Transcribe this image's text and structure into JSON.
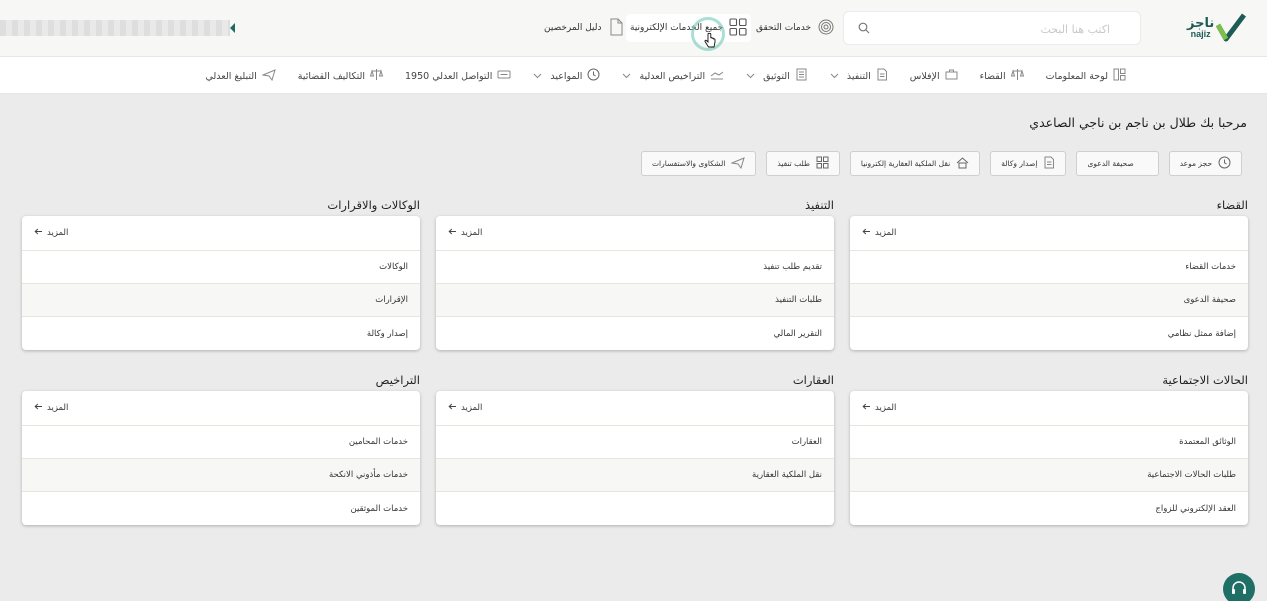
{
  "header": {
    "logo_ar": "ناجز",
    "logo_en": "najiz",
    "search_placeholder": "اكتب هنا البحث",
    "links": {
      "verification": "خدمات التحقق",
      "all_services": "جميع الخدمات الإلكترونية",
      "licensees_guide": "دليل المرخصين"
    }
  },
  "nav": {
    "items": [
      {
        "label": "لوحة المعلومات",
        "icon": "dashboard-icon",
        "dropdown": false
      },
      {
        "label": "القضاء",
        "icon": "scales-icon",
        "dropdown": false
      },
      {
        "label": "الإفلاس",
        "icon": "briefcase-icon",
        "dropdown": false
      },
      {
        "label": "التنفيذ",
        "icon": "document-icon",
        "dropdown": true
      },
      {
        "label": "التوثيق",
        "icon": "stack-icon",
        "dropdown": true
      },
      {
        "label": "التراخيص العدلية",
        "icon": "license-icon",
        "dropdown": true
      },
      {
        "label": "المواعيد",
        "icon": "clock-icon",
        "dropdown": true
      },
      {
        "label": "التواصل العدلي 1950",
        "icon": "message-icon",
        "dropdown": false
      },
      {
        "label": "التكاليف القضائية",
        "icon": "scales-icon",
        "dropdown": false
      },
      {
        "label": "التبليغ العدلي",
        "icon": "send-icon",
        "dropdown": false
      }
    ]
  },
  "greeting": "مرحبا بك طلال بن ناجم بن ناجي الصاعدي",
  "quick_actions": [
    {
      "label": "حجز موعد",
      "icon": "clock-icon"
    },
    {
      "label": "صحيفة الدعوى",
      "icon": "section-icon"
    },
    {
      "label": "إصدار وكالة",
      "icon": "document-icon"
    },
    {
      "label": "نقل الملكية العقارية إلكترونيا",
      "icon": "home-icon"
    },
    {
      "label": "طلب تنفيذ",
      "icon": "grid-icon"
    },
    {
      "label": "الشكاوى والاستفسارات",
      "icon": "send-icon"
    }
  ],
  "more_label": "المزيد",
  "sections": [
    {
      "title": "القضاء",
      "items": [
        "خدمات القضاء",
        "صحيفة الدعوى",
        "إضافة ممثل نظامي"
      ]
    },
    {
      "title": "التنفيذ",
      "items": [
        "تقديم طلب تنفيذ",
        "طلبات التنفيذ",
        "التقرير المالي"
      ]
    },
    {
      "title": "الوكالات والاقرارات",
      "items": [
        "الوكالات",
        "الإقرارات",
        "إصدار وكالة"
      ]
    },
    {
      "title": "الحالات الاجتماعية",
      "items": [
        "الوثائق المعتمدة",
        "طلبات الحالات الاجتماعية",
        "العقد الإلكتروني للزواج"
      ]
    },
    {
      "title": "العقارات",
      "items": [
        "العقارات",
        "نقل الملكية العقارية",
        ""
      ]
    },
    {
      "title": "التراخيص",
      "items": [
        "خدمات المحامين",
        "خدمات مأذوني الانكحة",
        "خدمات الموثقين"
      ]
    }
  ],
  "colors": {
    "brand_green": "#1e5b55",
    "accent_teal": "#62c4b2",
    "logo_light_green": "#7dbf4e"
  }
}
